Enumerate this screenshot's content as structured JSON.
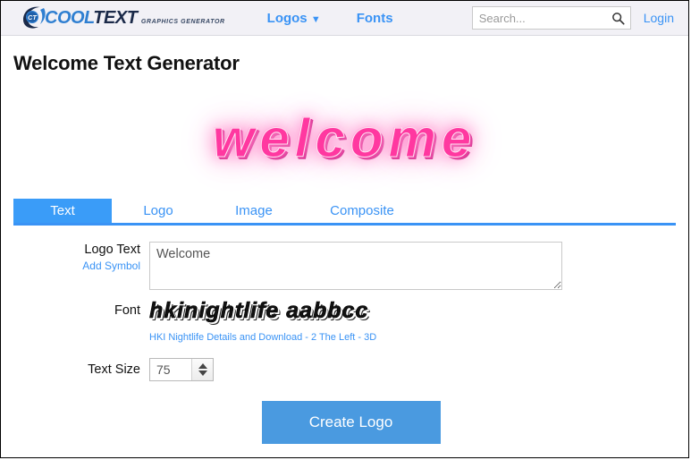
{
  "header": {
    "brand": {
      "icon": "cooltext-ct-logo-icon",
      "word_cool": "COOL",
      "word_text": "TEXT",
      "tagline": "GRAPHICS GENERATOR"
    },
    "nav": [
      {
        "label": "Logos",
        "caret": "▼"
      },
      {
        "label": "Fonts"
      }
    ],
    "search": {
      "placeholder": "Search...",
      "value": "",
      "icon": "search-icon"
    },
    "login_label": "Login",
    "background": "#f2f1f6",
    "link_color": "#3a93f5"
  },
  "page": {
    "title": "Welcome Text Generator"
  },
  "preview": {
    "logo_text": "welcome",
    "glow_color": "#ff7ac4",
    "fill_color": "#ff38a0"
  },
  "tabs": [
    {
      "label": "Text",
      "active": true
    },
    {
      "label": "Logo",
      "active": false
    },
    {
      "label": "Image",
      "active": false
    },
    {
      "label": "Composite",
      "active": false
    }
  ],
  "form": {
    "logo_text": {
      "label": "Logo Text",
      "add_symbol_label": "Add Symbol",
      "value": "Welcome",
      "placeholder": ""
    },
    "font": {
      "label": "Font",
      "preview_text": "hkinightlife aabbcc",
      "details_link": "HKI Nightlife Details and Download",
      "separator_1": " - ",
      "category_link": "2 The Left",
      "separator_2": " - ",
      "style_link": "3D"
    },
    "text_size": {
      "label": "Text Size",
      "value": "75"
    },
    "submit_label": "Create Logo",
    "accent_color": "#4a9ae0"
  }
}
